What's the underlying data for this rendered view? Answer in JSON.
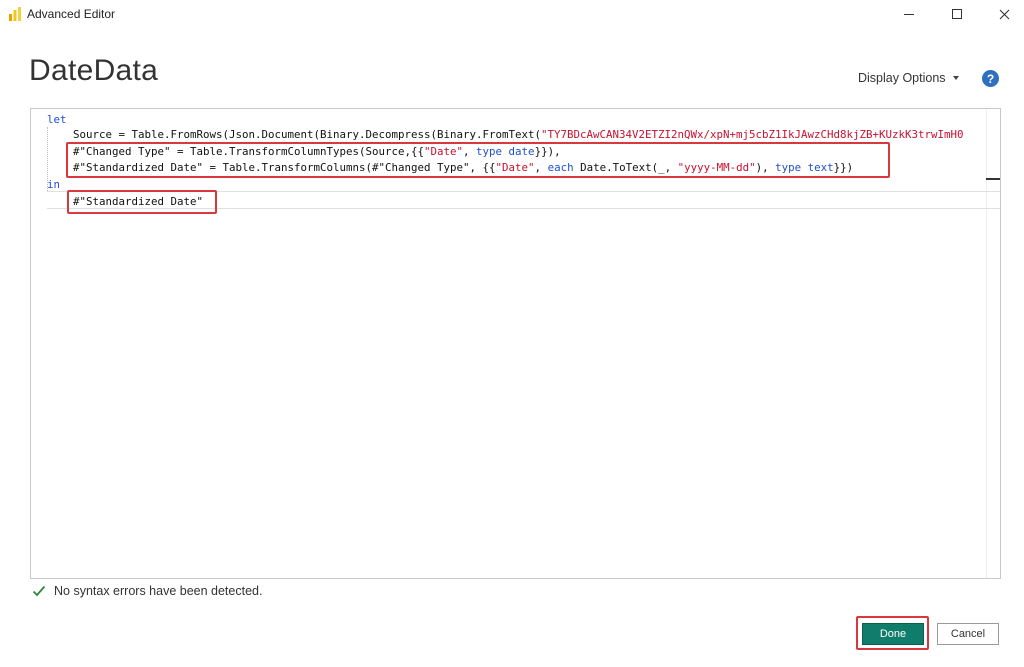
{
  "window": {
    "title": "Advanced Editor",
    "controls": {
      "minimize": "minimize",
      "maximize": "maximize",
      "close": "close"
    }
  },
  "header": {
    "query_name": "DateData",
    "display_options_label": "Display Options",
    "help_glyph": "?"
  },
  "code": {
    "lines": [
      {
        "tokens": [
          {
            "t": "kw",
            "v": "let"
          }
        ],
        "indent": 1
      },
      {
        "tokens": [
          {
            "t": "id",
            "v": "Source = Table.FromRows(Json.Document(Binary.Decompress(Binary.FromText("
          },
          {
            "t": "str",
            "v": "\"TY7BDcAwCAN34V2ETZI2nQWx/xpN+mj5cbZ1IkJAwzCHd8kjZB+KUzkK3trwImH0"
          }
        ],
        "indent": 2
      },
      {
        "tokens": [
          {
            "t": "id",
            "v": "#\"Changed Type\" = Table.TransformColumnTypes(Source,{{"
          },
          {
            "t": "str",
            "v": "\"Date\""
          },
          {
            "t": "id",
            "v": ", "
          },
          {
            "t": "kw",
            "v": "type date"
          },
          {
            "t": "id",
            "v": "}}),"
          }
        ],
        "indent": 2
      },
      {
        "tokens": [
          {
            "t": "id",
            "v": "#\"Standardized Date\" = Table.TransformColumns(#\"Changed Type\", {{"
          },
          {
            "t": "str",
            "v": "\"Date\""
          },
          {
            "t": "id",
            "v": ", "
          },
          {
            "t": "kw",
            "v": "each"
          },
          {
            "t": "id",
            "v": " Date.ToText(_, "
          },
          {
            "t": "str",
            "v": "\"yyyy-MM-dd\""
          },
          {
            "t": "id",
            "v": "), "
          },
          {
            "t": "kw",
            "v": "type text"
          },
          {
            "t": "id",
            "v": "}})"
          }
        ],
        "indent": 2
      },
      {
        "tokens": [
          {
            "t": "kw",
            "v": "in"
          }
        ],
        "indent": 1
      },
      {
        "tokens": [
          {
            "t": "id",
            "v": "#\"Standardized Date\""
          }
        ],
        "indent": 2
      }
    ]
  },
  "status": {
    "message": "No syntax errors have been detected.",
    "ok_color": "#2e8b3a"
  },
  "buttons": {
    "done_label": "Done",
    "cancel_label": "Cancel"
  },
  "colors": {
    "accent": "#107c6b",
    "highlight": "#d9383c",
    "keyword": "#1f4fd0",
    "string": "#c8102e"
  }
}
